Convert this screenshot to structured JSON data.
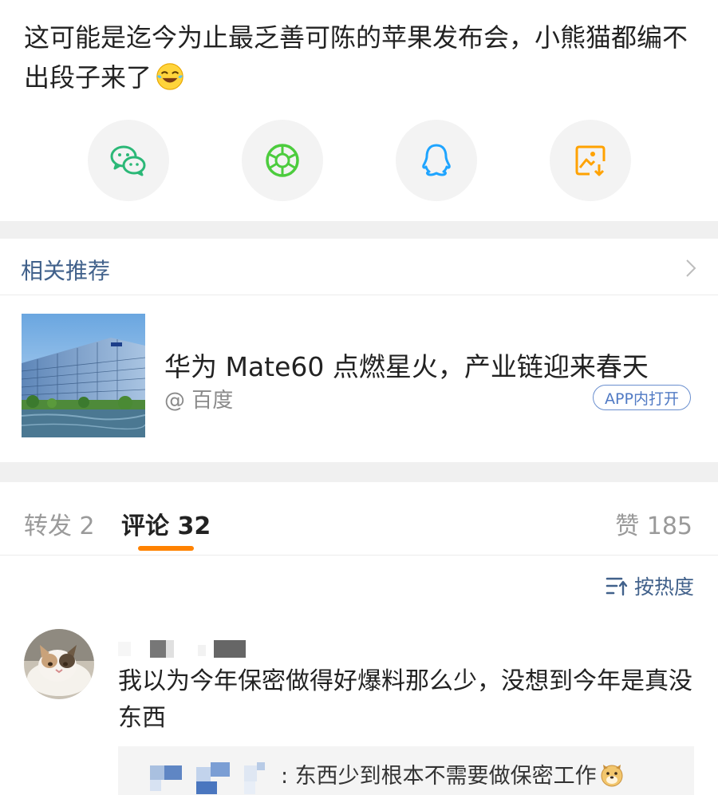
{
  "post": {
    "text": "这可能是迄今为止最乏善可陈的苹果发布会，小熊猫都编不出段子来了"
  },
  "share": {
    "buttons": [
      {
        "name": "wechat",
        "icon": "wechat-icon",
        "color": "#2bb877"
      },
      {
        "name": "moments",
        "icon": "moments-icon",
        "color": "#4ccc3d"
      },
      {
        "name": "qq",
        "icon": "qq-icon",
        "color": "#1ea4ff"
      },
      {
        "name": "save-image",
        "icon": "save-image-icon",
        "color": "#ffa200"
      }
    ]
  },
  "related": {
    "title": "相关推荐",
    "item": {
      "title": "华为 Mate60 点燃星火，产业链迎来春天",
      "source": "@ 百度",
      "badge": "APP内打开"
    }
  },
  "tabs": {
    "repost": "转发 2",
    "comments": "评论 32",
    "likes": "赞 185",
    "accent": "#ff8200"
  },
  "sort": {
    "label": "按热度"
  },
  "comment": {
    "text": "我以为今年保密做得好爆料那么少，没想到今年是真没东西",
    "reply": {
      "text": ": 东西少到根本不需要做保密工作"
    }
  },
  "colors": {
    "link": "#41618b",
    "badge": "#507ac4",
    "divider": "#f0f0f0"
  }
}
